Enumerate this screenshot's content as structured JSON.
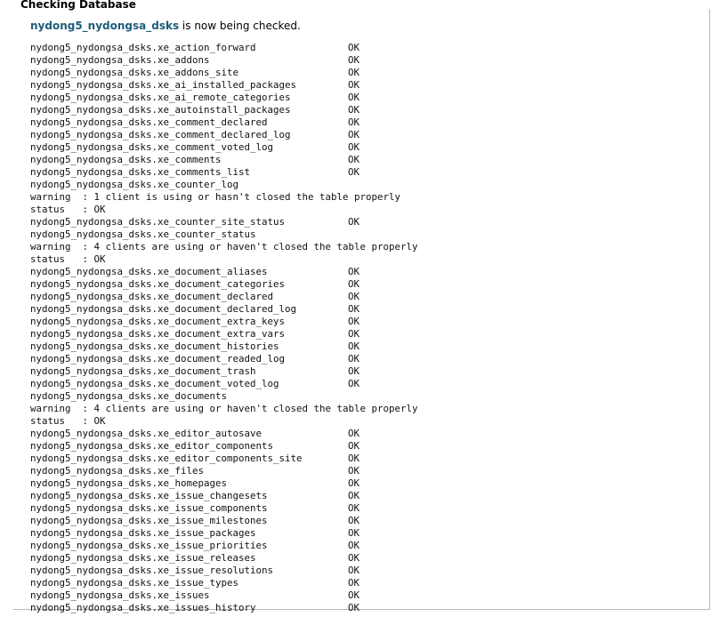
{
  "heading": "Checking Database",
  "intro": {
    "db_name": "nydong5_nydongsa_dsks",
    "suffix": " is now being checked."
  },
  "lines": [
    {
      "table": "nydong5_nydongsa_dsks.xe_action_forward",
      "status": "OK"
    },
    {
      "table": "nydong5_nydongsa_dsks.xe_addons",
      "status": "OK"
    },
    {
      "table": "nydong5_nydongsa_dsks.xe_addons_site",
      "status": "OK"
    },
    {
      "table": "nydong5_nydongsa_dsks.xe_ai_installed_packages",
      "status": "OK"
    },
    {
      "table": "nydong5_nydongsa_dsks.xe_ai_remote_categories",
      "status": "OK"
    },
    {
      "table": "nydong5_nydongsa_dsks.xe_autoinstall_packages",
      "status": "OK"
    },
    {
      "table": "nydong5_nydongsa_dsks.xe_comment_declared",
      "status": "OK"
    },
    {
      "table": "nydong5_nydongsa_dsks.xe_comment_declared_log",
      "status": "OK"
    },
    {
      "table": "nydong5_nydongsa_dsks.xe_comment_voted_log",
      "status": "OK"
    },
    {
      "table": "nydong5_nydongsa_dsks.xe_comments",
      "status": "OK"
    },
    {
      "table": "nydong5_nydongsa_dsks.xe_comments_list",
      "status": "OK"
    },
    {
      "table": "nydong5_nydongsa_dsks.xe_counter_log",
      "status": ""
    },
    {
      "table": "warning  : 1 client is using or hasn't closed the table properly",
      "status": ""
    },
    {
      "table": "status   : OK",
      "status": ""
    },
    {
      "table": "nydong5_nydongsa_dsks.xe_counter_site_status",
      "status": "OK"
    },
    {
      "table": "nydong5_nydongsa_dsks.xe_counter_status",
      "status": ""
    },
    {
      "table": "warning  : 4 clients are using or haven't closed the table properly",
      "status": ""
    },
    {
      "table": "status   : OK",
      "status": ""
    },
    {
      "table": "nydong5_nydongsa_dsks.xe_document_aliases",
      "status": "OK"
    },
    {
      "table": "nydong5_nydongsa_dsks.xe_document_categories",
      "status": "OK"
    },
    {
      "table": "nydong5_nydongsa_dsks.xe_document_declared",
      "status": "OK"
    },
    {
      "table": "nydong5_nydongsa_dsks.xe_document_declared_log",
      "status": "OK"
    },
    {
      "table": "nydong5_nydongsa_dsks.xe_document_extra_keys",
      "status": "OK"
    },
    {
      "table": "nydong5_nydongsa_dsks.xe_document_extra_vars",
      "status": "OK"
    },
    {
      "table": "nydong5_nydongsa_dsks.xe_document_histories",
      "status": "OK"
    },
    {
      "table": "nydong5_nydongsa_dsks.xe_document_readed_log",
      "status": "OK"
    },
    {
      "table": "nydong5_nydongsa_dsks.xe_document_trash",
      "status": "OK"
    },
    {
      "table": "nydong5_nydongsa_dsks.xe_document_voted_log",
      "status": "OK"
    },
    {
      "table": "nydong5_nydongsa_dsks.xe_documents",
      "status": ""
    },
    {
      "table": "warning  : 4 clients are using or haven't closed the table properly",
      "status": ""
    },
    {
      "table": "status   : OK",
      "status": ""
    },
    {
      "table": "nydong5_nydongsa_dsks.xe_editor_autosave",
      "status": "OK"
    },
    {
      "table": "nydong5_nydongsa_dsks.xe_editor_components",
      "status": "OK"
    },
    {
      "table": "nydong5_nydongsa_dsks.xe_editor_components_site",
      "status": "OK"
    },
    {
      "table": "nydong5_nydongsa_dsks.xe_files",
      "status": "OK"
    },
    {
      "table": "nydong5_nydongsa_dsks.xe_homepages",
      "status": "OK"
    },
    {
      "table": "nydong5_nydongsa_dsks.xe_issue_changesets",
      "status": "OK"
    },
    {
      "table": "nydong5_nydongsa_dsks.xe_issue_components",
      "status": "OK"
    },
    {
      "table": "nydong5_nydongsa_dsks.xe_issue_milestones",
      "status": "OK"
    },
    {
      "table": "nydong5_nydongsa_dsks.xe_issue_packages",
      "status": "OK"
    },
    {
      "table": "nydong5_nydongsa_dsks.xe_issue_priorities",
      "status": "OK"
    },
    {
      "table": "nydong5_nydongsa_dsks.xe_issue_releases",
      "status": "OK"
    },
    {
      "table": "nydong5_nydongsa_dsks.xe_issue_resolutions",
      "status": "OK"
    },
    {
      "table": "nydong5_nydongsa_dsks.xe_issue_types",
      "status": "OK"
    },
    {
      "table": "nydong5_nydongsa_dsks.xe_issues",
      "status": "OK"
    },
    {
      "table": "nydong5_nydongsa_dsks.xe_issues_history",
      "status": "OK"
    }
  ]
}
